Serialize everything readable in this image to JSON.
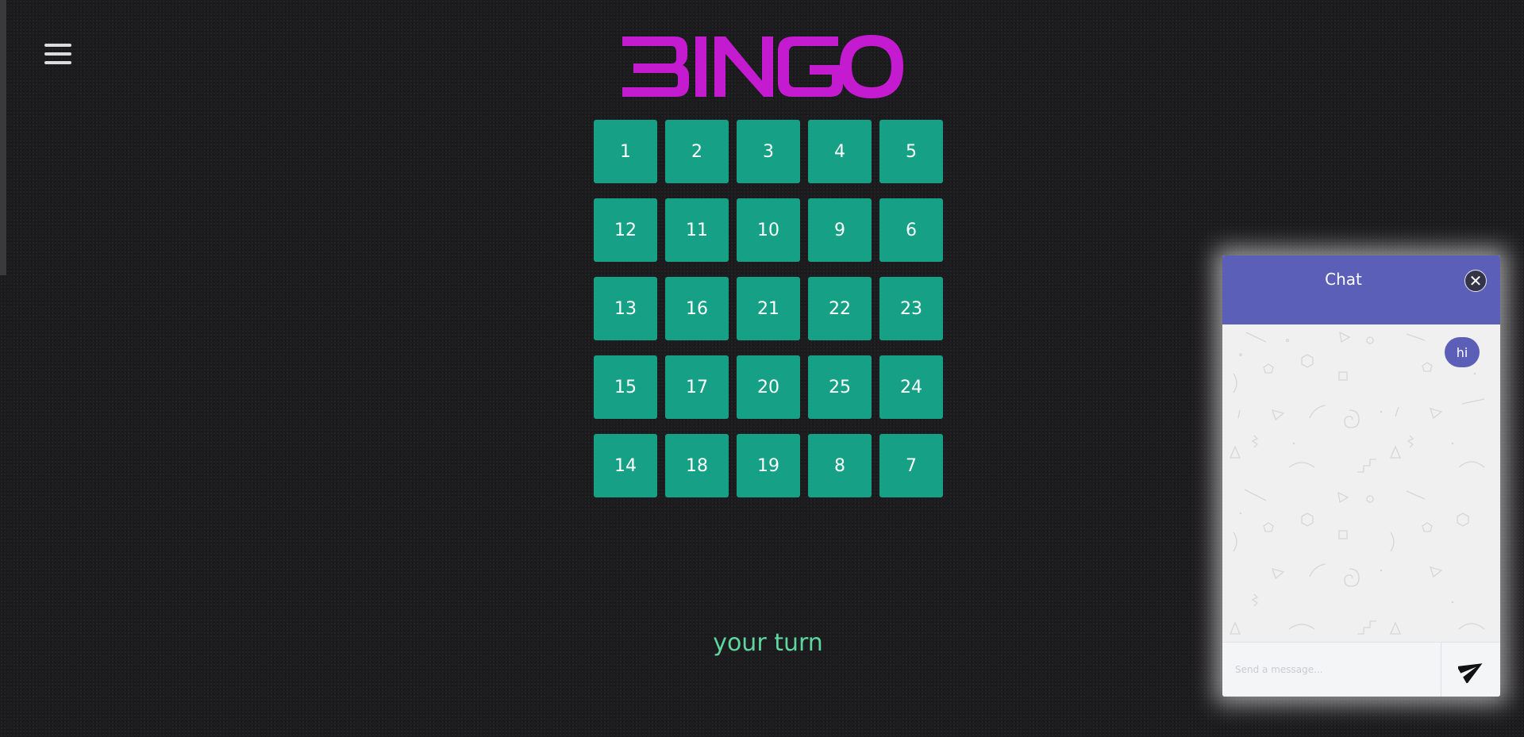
{
  "app": {
    "logo_text": "BINGO",
    "logo_color": "#c51bd0",
    "menu_icon": "hamburger-menu-icon"
  },
  "board": {
    "cell_color": "#16a085",
    "rows": [
      [
        "1",
        "2",
        "3",
        "4",
        "5"
      ],
      [
        "12",
        "11",
        "10",
        "9",
        "6"
      ],
      [
        "13",
        "16",
        "21",
        "22",
        "23"
      ],
      [
        "15",
        "17",
        "20",
        "25",
        "24"
      ],
      [
        "14",
        "18",
        "19",
        "8",
        "7"
      ]
    ]
  },
  "status": {
    "turn_text": "your turn",
    "color": "#5ed6a0"
  },
  "chat": {
    "title": "Chat",
    "header_color": "#5b5fb8",
    "close_icon": "close-icon",
    "messages": [
      {
        "text": "hi",
        "from": "me"
      }
    ],
    "input_placeholder": "Send a message...",
    "input_value": "",
    "send_icon": "send-paper-plane-icon"
  }
}
